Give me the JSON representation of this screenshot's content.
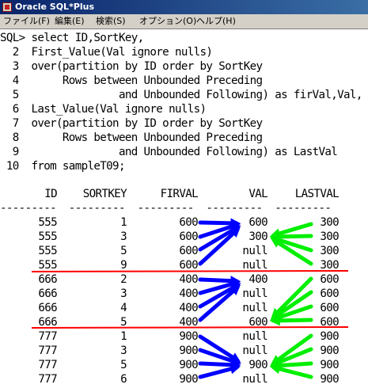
{
  "window": {
    "title": "Oracle SQL*Plus"
  },
  "menu": [
    "ファイル(F)",
    "編集(E)",
    "検索(S)",
    "オプション(O)",
    "ヘルプ(H)"
  ],
  "sql": [
    "SQL> select ID,SortKey,",
    "  2  First_Value(Val ignore nulls)",
    "  3  over(partition by ID order by SortKey",
    "  4       Rows between Unbounded Preceding",
    "  5                and Unbounded Following) as firVal,Val,",
    "  6  Last_Value(Val ignore nulls)",
    "  7  over(partition by ID order by SortKey",
    "  8       Rows between Unbounded Preceding",
    "  9                and Unbounded Following) as LastVal",
    " 10  from sampleT09;"
  ],
  "results": {
    "headers": [
      "ID",
      "SORTKEY",
      "FIRVAL",
      "VAL",
      "LASTVAL"
    ],
    "separator": "---------  ---------  ---------  ---------  ---------",
    "rows": [
      [
        "555",
        "1",
        "600",
        "600",
        "300"
      ],
      [
        "555",
        "3",
        "600",
        "300",
        "300"
      ],
      [
        "555",
        "5",
        "600",
        "null",
        "300"
      ],
      [
        "555",
        "9",
        "600",
        "null",
        "300"
      ],
      [
        "666",
        "2",
        "400",
        "400",
        "600"
      ],
      [
        "666",
        "3",
        "400",
        "null",
        "600"
      ],
      [
        "666",
        "4",
        "400",
        "null",
        "600"
      ],
      [
        "666",
        "5",
        "400",
        "600",
        "600"
      ],
      [
        "777",
        "1",
        "900",
        "null",
        "900"
      ],
      [
        "777",
        "3",
        "900",
        "null",
        "900"
      ],
      [
        "777",
        "5",
        "900",
        "900",
        "900"
      ],
      [
        "777",
        "6",
        "900",
        "null",
        "900"
      ]
    ]
  },
  "colors": {
    "blue_arrows": "#0000ff",
    "green_arrows": "#00ee00",
    "red_lines": "#ff0000"
  }
}
